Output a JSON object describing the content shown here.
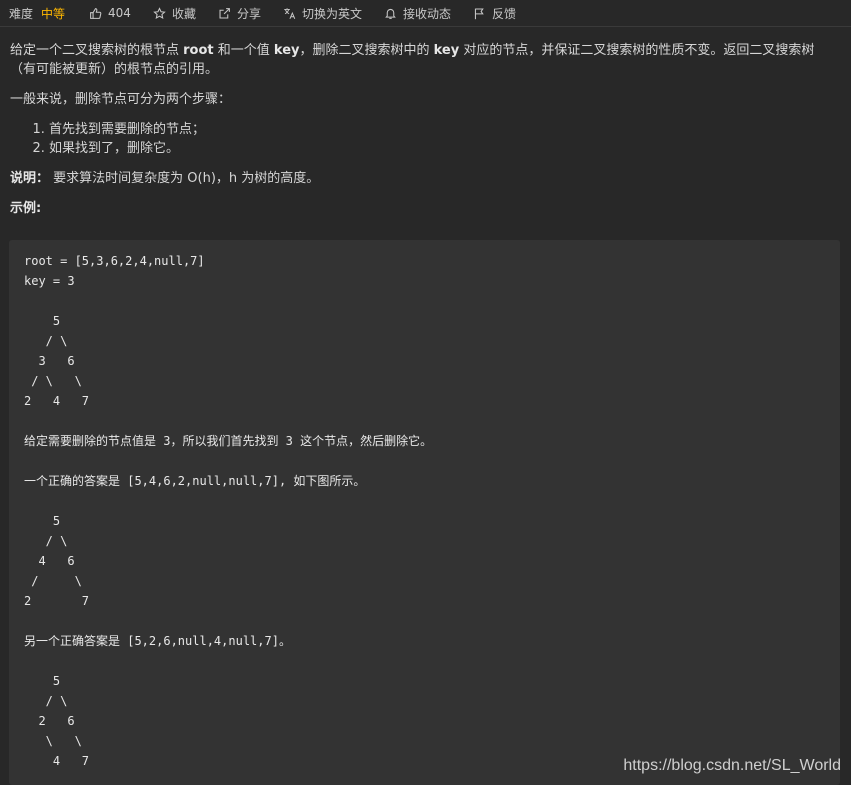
{
  "toolbar": {
    "difficulty_label": "难度",
    "difficulty_value": "中等",
    "difficulty_color": "#ffb800",
    "likes": "404",
    "favorite": "收藏",
    "share": "分享",
    "switch_lang": "切换为英文",
    "notify": "接收动态",
    "feedback": "反馈",
    "icons": [
      "thumbs-up-icon",
      "star-icon",
      "share-icon",
      "translate-icon",
      "bell-icon",
      "flag-icon"
    ]
  },
  "description": {
    "p1_a": "给定一个二叉搜索树的根节点 ",
    "p1_root": "root",
    "p1_b": " 和一个值 ",
    "p1_key": "key",
    "p1_c": "，删除二叉搜索树中的 ",
    "p1_key2": "key",
    "p1_d": " 对应的节点，并保证二叉搜索树的性质不变。返回二叉搜索树（有可能被更新）的根节点的引用。",
    "p2": "一般来说，删除节点可分为两个步骤：",
    "steps": [
      "首先找到需要删除的节点；",
      "如果找到了，删除它。"
    ],
    "note_label": "说明：",
    "note_text": " 要求算法时间复杂度为 O(h)，h 为树的高度。",
    "example_label": "示例:"
  },
  "example_code": "root = [5,3,6,2,4,null,7]\nkey = 3\n\n    5\n   / \\\n  3   6\n / \\   \\\n2   4   7\n\n给定需要删除的节点值是 3，所以我们首先找到 3 这个节点，然后删除它。\n\n一个正确的答案是 [5,4,6,2,null,null,7], 如下图所示。\n\n    5\n   / \\\n  4   6\n /     \\\n2       7\n\n另一个正确答案是 [5,2,6,null,4,null,7]。\n\n    5\n   / \\\n  2   6\n   \\   \\\n    4   7",
  "watermark": "https://blog.csdn.net/SL_World"
}
